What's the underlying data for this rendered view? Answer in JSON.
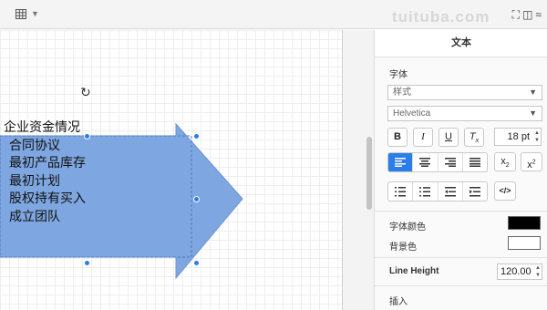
{
  "panel": {
    "title": "文本",
    "font_section": "字体",
    "style_select": "样式",
    "font_select": "Helvetica",
    "bold": "B",
    "italic": "I",
    "underline": "U",
    "font_size": "18 pt",
    "code": "</>",
    "font_color_label": "字体颜色",
    "background_label": "背景色",
    "line_height_label": "Line Height",
    "line_height_value": "120.00",
    "insert_label": "插入",
    "font_color": "#000000",
    "background_color": "#ffffff"
  },
  "diagram": {
    "lines": [
      "企业资金情况",
      "合同协议",
      "最初产品库存",
      "最初计划",
      "股权持有买入",
      "成立团队"
    ],
    "fill_color": "#7ea6e0"
  },
  "watermark": "tuituba.com",
  "accent": "#2b7de9"
}
